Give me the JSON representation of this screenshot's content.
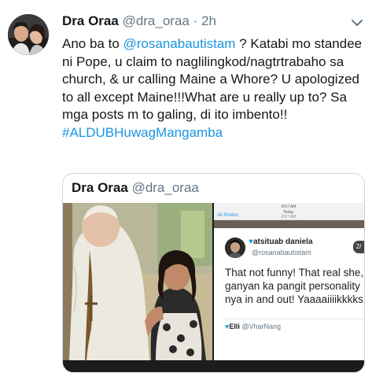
{
  "tweet": {
    "display_name": "Dra Oraa",
    "handle": "@dra_oraa",
    "separator": "·",
    "time": "2h",
    "body": {
      "p1": "Ano ba to ",
      "mention": "@rosanabautistam",
      "p2": " ? Katabi mo standee ni Pope, u claim to naglilingkod/nagtrtrabaho sa church, & ur calling Maine a Whore? U apologized to all except Maine!!!What are u really up to? Sa mga posts m to galing, di ito imbento!!",
      "hashtag": "#ALDUBHuwagMangamba"
    }
  },
  "quote": {
    "display_name": "Dra Oraa",
    "handle": "@dra_oraa",
    "screenshot": {
      "back": "All Photos",
      "clock": "8:57 AM",
      "today": "Today",
      "stamp": "8:57 AM",
      "user_name": "atsituab daniela",
      "user_handle": "@rosanabautistam",
      "badge": "2/",
      "text": "That not funny! That real she, ganyan ka pangit personality nya in and out! Yaaaaiiiikkkks",
      "reply_name": "Elli",
      "reply_handle": "@VharNang"
    }
  },
  "colors": {
    "link": "#1b95e0",
    "secondary": "#657786",
    "border": "#ccd6dd"
  },
  "icons": {
    "chevron": "chevron-down-icon",
    "heart": "blue-heart-icon"
  }
}
